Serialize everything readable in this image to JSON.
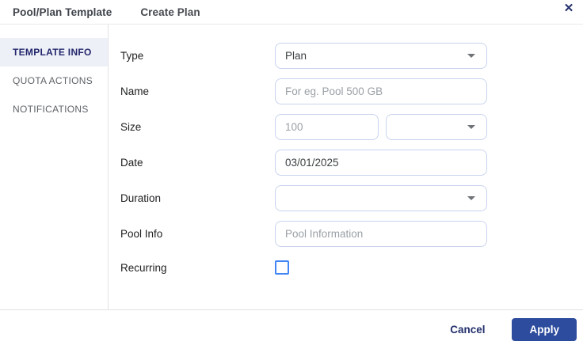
{
  "header": {
    "title": "Pool/Plan Template",
    "subtitle": "Create Plan",
    "close_icon": "✕"
  },
  "sidebar": {
    "items": [
      {
        "label": "TEMPLATE INFO",
        "active": true
      },
      {
        "label": "QUOTA ACTIONS",
        "active": false
      },
      {
        "label": "NOTIFICATIONS",
        "active": false
      }
    ]
  },
  "form": {
    "type": {
      "label": "Type",
      "value": "Plan"
    },
    "name": {
      "label": "Name",
      "value": "",
      "placeholder": "For eg. Pool 500 GB"
    },
    "size": {
      "label": "Size",
      "value": "",
      "placeholder": "100",
      "unit_value": ""
    },
    "date": {
      "label": "Date",
      "value": "03/01/2025"
    },
    "duration": {
      "label": "Duration",
      "value": ""
    },
    "pool_info": {
      "label": "Pool Info",
      "value": "",
      "placeholder": "Pool Information"
    },
    "recurring": {
      "label": "Recurring",
      "checked": false
    }
  },
  "footer": {
    "cancel_label": "Cancel",
    "apply_label": "Apply"
  },
  "colors": {
    "accent": "#2d4c9e",
    "active_tab_text": "#23276b",
    "active_tab_bg": "#eef0f8",
    "checkbox_blue": "#4285f4",
    "field_border": "#c9d3ee",
    "placeholder_text": "#9aa0a6",
    "label_text": "#202124",
    "muted_text": "#5f6368"
  }
}
